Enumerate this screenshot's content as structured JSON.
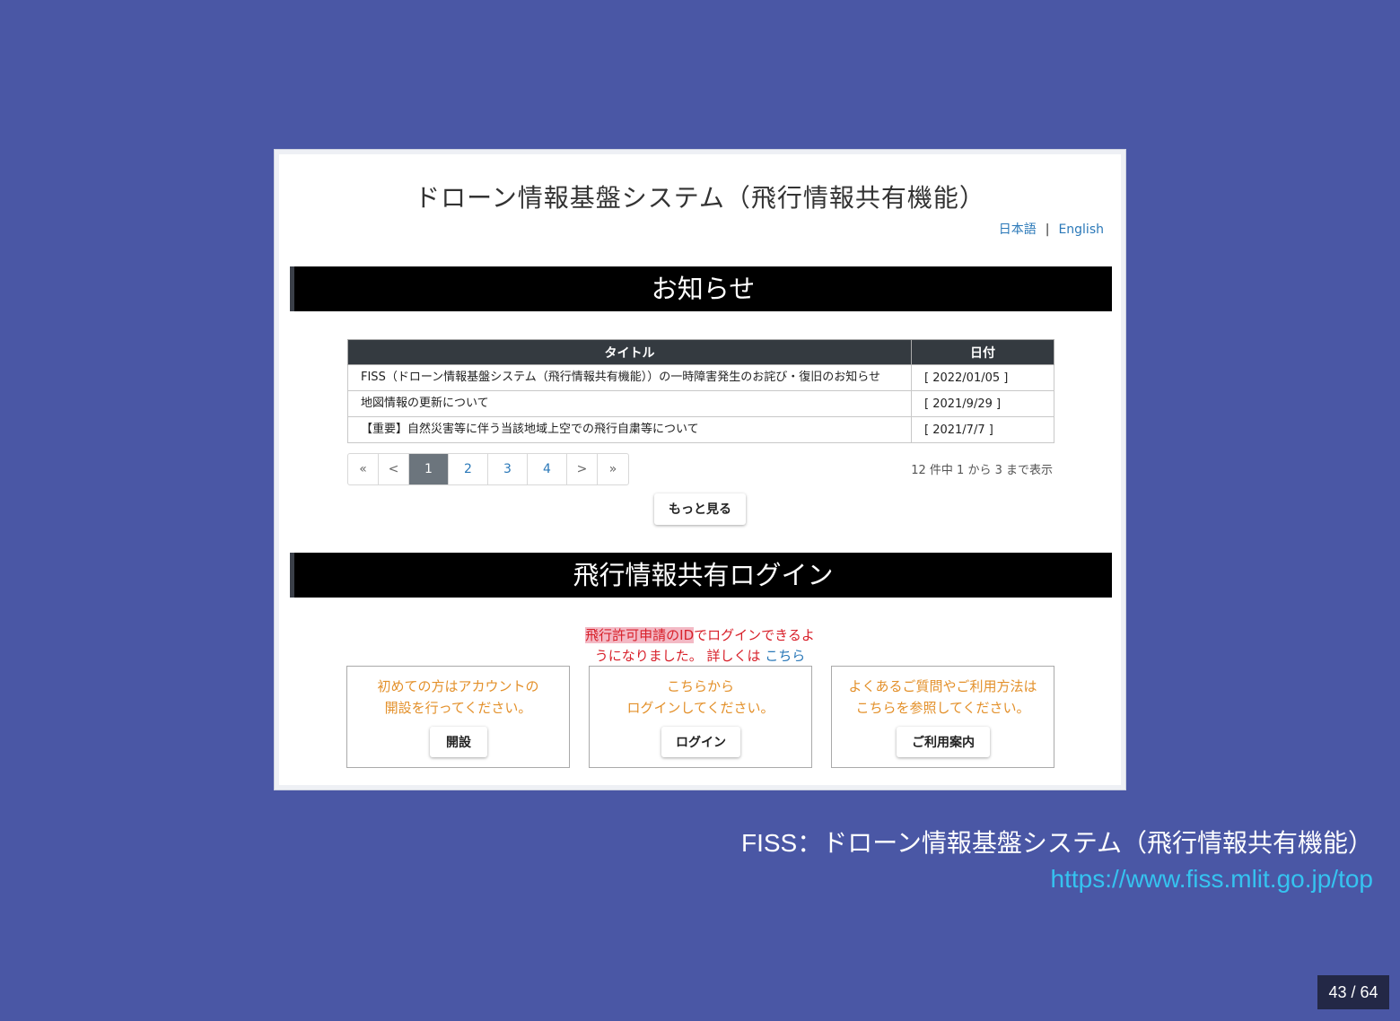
{
  "site": {
    "title": "ドローン情報基盤システム（飛行情報共有機能）",
    "lang_ja": "日本語",
    "lang_sep": "|",
    "lang_en": "English"
  },
  "notice": {
    "heading": "お知らせ",
    "columns": [
      "タイトル",
      "日付"
    ],
    "rows": [
      {
        "title": "FISS（ドローン情報基盤システム（飛行情報共有機能））の一時障害発生のお詫び・復旧のお知らせ",
        "date": "[ 2022/01/05 ]"
      },
      {
        "title": "地図情報の更新について",
        "date": "[ 2021/9/29 ]"
      },
      {
        "title": "【重要】自然災害等に伴う当該地域上空での飛行自粛等について",
        "date": "[ 2021/7/7 ]"
      }
    ],
    "pager": {
      "first": "«",
      "prev": "<",
      "pages": [
        "1",
        "2",
        "3",
        "4"
      ],
      "next": ">",
      "last": "»"
    },
    "count_text": "12 件中 1 から 3 まで表示",
    "more_button": "もっと見る"
  },
  "login": {
    "heading": "飛行情報共有ログイン",
    "note_highlight": "飛行許可申請のID",
    "note_line1_rest": "でログインできるよ",
    "note_line2": "うになりました。 詳しくは ",
    "note_link": "こちら",
    "cards": [
      {
        "line1": "初めての方はアカウントの",
        "line2": "開設を行ってください。",
        "button": "開設"
      },
      {
        "line1": "こちらから",
        "line2": "ログインしてください。",
        "button": "ログイン"
      },
      {
        "line1": "よくあるご質問やご利用方法は",
        "line2": "こちらを参照してください。",
        "button": "ご利用案内"
      }
    ]
  },
  "caption": {
    "text": "FISS：ドローン情報基盤システム（飛行情報共有機能）",
    "url": "https://www.fiss.mlit.go.jp/top"
  },
  "slide": {
    "page": "43 / 64"
  },
  "colors": {
    "background": "#4a57a5",
    "accent_orange": "#e3902a",
    "link": "#2a78b8",
    "alert_red": "#d8202a"
  }
}
